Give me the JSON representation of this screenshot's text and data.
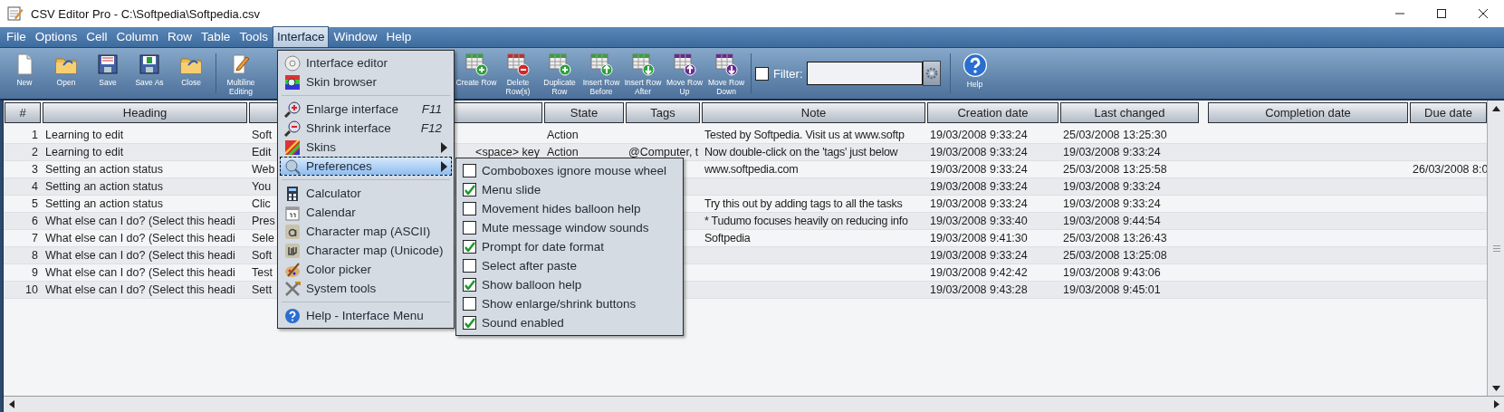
{
  "window": {
    "title": "CSV Editor Pro - C:\\Softpedia\\Softpedia.csv"
  },
  "menubar": [
    {
      "label": "File",
      "selected": false
    },
    {
      "label": "Options",
      "selected": false
    },
    {
      "label": "Cell",
      "selected": false
    },
    {
      "label": "Column",
      "selected": false
    },
    {
      "label": "Row",
      "selected": false
    },
    {
      "label": "Table",
      "selected": false
    },
    {
      "label": "Tools",
      "selected": false
    },
    {
      "label": "Interface",
      "selected": true
    },
    {
      "label": "Window",
      "selected": false
    },
    {
      "label": "Help",
      "selected": false
    }
  ],
  "toolbar": {
    "file_buttons": [
      {
        "label": "New"
      },
      {
        "label": "Open"
      },
      {
        "label": "Save"
      },
      {
        "label": "Save As"
      },
      {
        "label": "Close"
      }
    ],
    "edit_buttons": [
      {
        "label": "Multiline Editing"
      }
    ],
    "row_buttons": [
      {
        "label": "Create Row"
      },
      {
        "label": "Delete Row(s)"
      },
      {
        "label": "Duplicate Row"
      },
      {
        "label": "Insert Row Before"
      },
      {
        "label": "Insert Row After"
      },
      {
        "label": "Move Row Up"
      },
      {
        "label": "Move Row Down"
      }
    ],
    "filter": {
      "label": "Filter:",
      "checked": false
    },
    "help_button": {
      "label": "Help"
    }
  },
  "table": {
    "columns": [
      {
        "label": "#"
      },
      {
        "label": "Heading"
      },
      {},
      {
        "label": "State"
      },
      {
        "label": "Tags"
      },
      {
        "label": "Note"
      },
      {
        "label": "Creation date"
      },
      {
        "label": "Last changed"
      },
      {
        "label": "Completion date"
      },
      {
        "label": "Due date"
      }
    ],
    "rows": [
      {
        "number": "1",
        "heading": "Learning to edit",
        "column_3": "Soft",
        "state": "Action",
        "note": "Tested by Softpedia. Visit us at www.softp",
        "creation_date": "19/03/2008 9:33:24",
        "last_changed": "25/03/2008 13:25:30"
      },
      {
        "number": "2",
        "heading": "Learning to edit",
        "column_3": "Edit",
        "column_3_tail": "<space> key",
        "state": "Action",
        "tags": "@Computer, t",
        "note": "Now double-click on the 'tags' just below",
        "creation_date": "19/03/2008 9:33:24",
        "last_changed": "19/03/2008 9:33:24"
      },
      {
        "number": "3",
        "heading": "Setting an action status",
        "column_3": "Web",
        "note": "www.softpedia.com",
        "creation_date": "19/03/2008 9:33:24",
        "last_changed": "25/03/2008 13:25:58",
        "due_date": "26/03/2008 8:0"
      },
      {
        "number": "4",
        "heading": "Setting an action status",
        "column_3": "You",
        "creation_date": "19/03/2008 9:33:24",
        "last_changed": "19/03/2008 9:33:24"
      },
      {
        "number": "5",
        "heading": "Setting an action status",
        "column_3": "Clic",
        "note": "Try this out by adding tags to all the tasks",
        "creation_date": "19/03/2008 9:33:24",
        "last_changed": "19/03/2008 9:33:24"
      },
      {
        "number": "6",
        "heading": "What else can I do? (Select this headi",
        "column_3": "Pres",
        "note": "* Tudumo focuses heavily on reducing info",
        "creation_date": "19/03/2008 9:33:40",
        "last_changed": "19/03/2008 9:44:54"
      },
      {
        "number": "7",
        "heading": "What else can I do? (Select this headi",
        "column_3": "Sele",
        "note": "Softpedia",
        "creation_date": "19/03/2008 9:41:30",
        "last_changed": "25/03/2008 13:26:43"
      },
      {
        "number": "8",
        "heading": "What else can I do? (Select this headi",
        "column_3": "Soft",
        "creation_date": "19/03/2008 9:33:24",
        "last_changed": "25/03/2008 13:25:08"
      },
      {
        "number": "9",
        "heading": "What else can I do? (Select this headi",
        "column_3": "Test",
        "creation_date": "19/03/2008 9:42:42",
        "last_changed": "19/03/2008 9:43:06"
      },
      {
        "number": "10",
        "heading": "What else can I do? (Select this headi",
        "column_3": "Sett",
        "creation_date": "19/03/2008 9:43:28",
        "last_changed": "19/03/2008 9:45:01"
      }
    ]
  },
  "interface_menu": {
    "items": [
      {
        "kind": "item",
        "label": "Interface editor",
        "selected": false
      },
      {
        "kind": "item",
        "label": "Skin browser",
        "selected": false
      },
      {
        "kind": "separator"
      },
      {
        "kind": "item",
        "label": "Enlarge interface",
        "shortcut": "F11",
        "selected": false
      },
      {
        "kind": "item",
        "label": "Shrink interface",
        "shortcut": "F12",
        "selected": false
      },
      {
        "kind": "submenu",
        "label": "Skins",
        "selected": false
      },
      {
        "kind": "submenu",
        "label": "Preferences",
        "selected": true
      },
      {
        "kind": "separator"
      },
      {
        "kind": "item",
        "label": "Calculator",
        "selected": false
      },
      {
        "kind": "item",
        "label": "Calendar",
        "selected": false
      },
      {
        "kind": "item",
        "label": "Character map (ASCII)",
        "selected": false
      },
      {
        "kind": "item",
        "label": "Character map (Unicode)",
        "selected": false
      },
      {
        "kind": "item",
        "label": "Color picker",
        "selected": false
      },
      {
        "kind": "item",
        "label": "System tools",
        "selected": false
      },
      {
        "kind": "separator"
      },
      {
        "kind": "item",
        "label": "Help - Interface Menu",
        "selected": false
      }
    ]
  },
  "preferences_menu": {
    "items": [
      {
        "label": "Comboboxes ignore mouse wheel",
        "checked": false
      },
      {
        "label": "Menu slide",
        "checked": true
      },
      {
        "label": "Movement hides balloon help",
        "checked": false
      },
      {
        "label": "Mute message window sounds",
        "checked": false
      },
      {
        "label": "Prompt for date format",
        "checked": true
      },
      {
        "label": "Select after paste",
        "checked": false
      },
      {
        "label": "Show balloon help",
        "checked": true
      },
      {
        "label": "Show enlarge/shrink buttons",
        "checked": false
      },
      {
        "label": "Sound enabled",
        "checked": true
      }
    ]
  }
}
